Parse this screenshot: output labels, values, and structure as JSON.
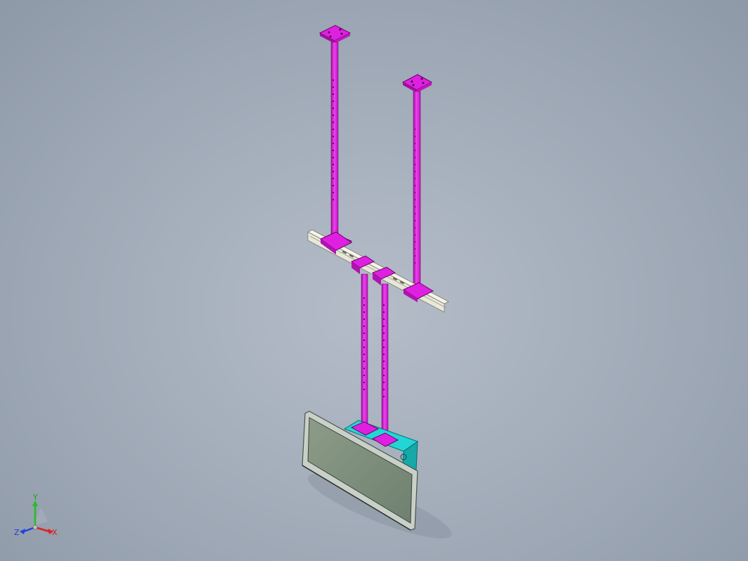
{
  "viewport": {
    "background_top": "#b4bcc8",
    "background_bottom": "#8e99a8"
  },
  "model": {
    "pole_color": "#e020e0",
    "pole_edge": "#8a0a8a",
    "rail_color": "#e6e6d6",
    "screen_glass": "#7f8f7c",
    "screen_frame": "#c8cfc8",
    "box_color": "#20d8d8"
  },
  "triad": {
    "x_label": "X",
    "y_label": "Y",
    "z_label": "Z",
    "x_color": "#e02020",
    "y_color": "#20c020",
    "z_color": "#2040e0"
  }
}
